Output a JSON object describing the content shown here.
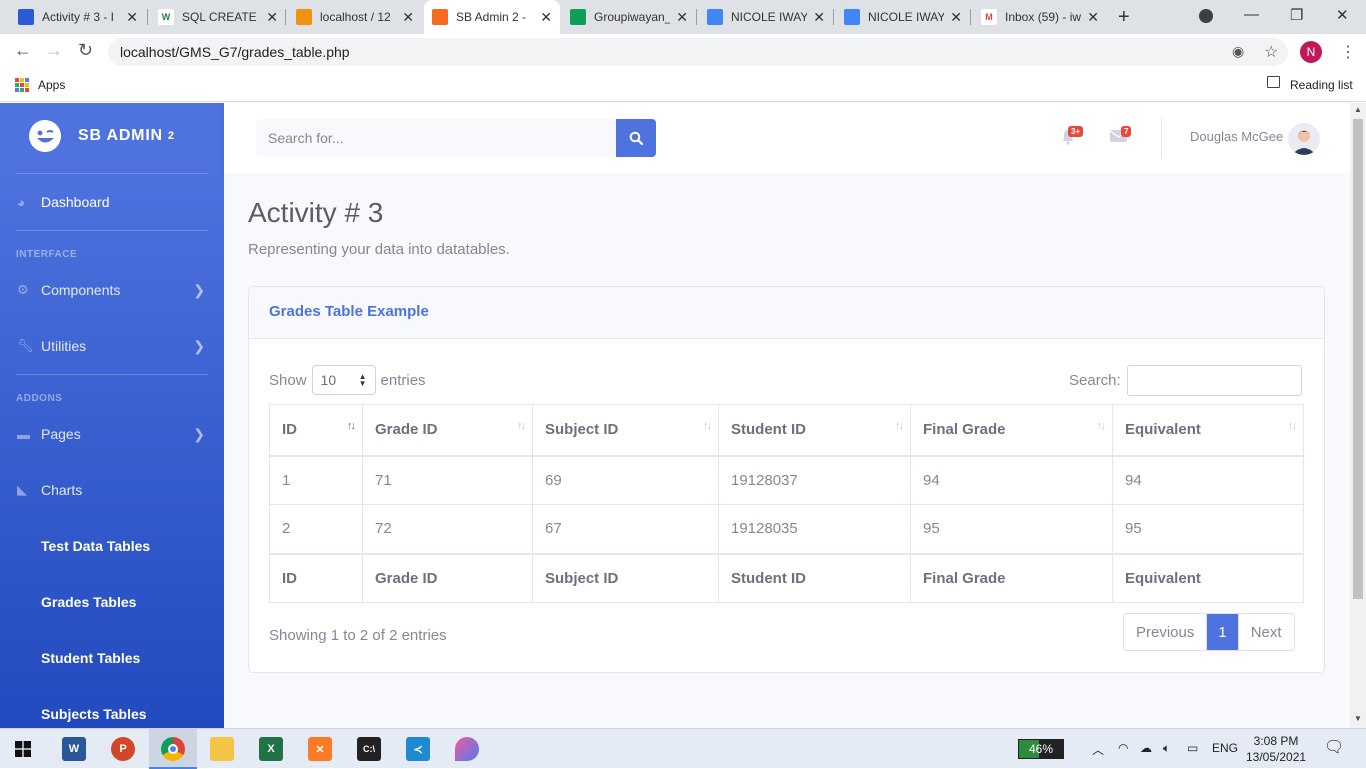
{
  "browser": {
    "tabs": [
      {
        "label": "Activity # 3 - I",
        "icon_color": "#2a5bd7",
        "icon_text": ""
      },
      {
        "label": "SQL CREATE T",
        "icon_color": "#000000",
        "icon_text": "W"
      },
      {
        "label": "localhost / 12",
        "icon_color": "#f29111",
        "icon_text": ""
      },
      {
        "label": "SB Admin 2 -",
        "icon_color": "#f26b21",
        "icon_text": ""
      },
      {
        "label": "Groupiwayan_",
        "icon_color": "#0f9d58",
        "icon_text": ""
      },
      {
        "label": "NICOLE IWAY",
        "icon_color": "#4285f4",
        "icon_text": ""
      },
      {
        "label": "NICOLE IWAY",
        "icon_color": "#4285f4",
        "icon_text": ""
      },
      {
        "label": "Inbox (59) - iw",
        "icon_color": "#ea4335",
        "icon_text": "M"
      }
    ],
    "url": "localhost/GMS_G7/grades_table.php",
    "profile_initial": "N",
    "bookmarks": {
      "apps_label": "Apps",
      "reading_list": "Reading list"
    }
  },
  "sidebar": {
    "brand": "SB ADMIN",
    "brand_sup": "2",
    "dashboard": "Dashboard",
    "heading_interface": "INTERFACE",
    "components": "Components",
    "utilities": "Utilities",
    "heading_addons": "ADDONS",
    "pages": "Pages",
    "charts": "Charts",
    "sub_items": [
      "Test Data Tables",
      "Grades Tables",
      "Student Tables",
      "Subjects Tables"
    ]
  },
  "topbar": {
    "search_placeholder": "Search for...",
    "alerts_badge": "3+",
    "messages_badge": "7",
    "user_name": "Douglas McGee"
  },
  "page": {
    "title": "Activity # 3",
    "subtitle": "Representing your data into datatables."
  },
  "card": {
    "header": "Grades Table Example",
    "show_label": "Show",
    "entries_value": "10",
    "entries_label": "entries",
    "search_label": "Search:",
    "columns": [
      "ID",
      "Grade ID",
      "Subject ID",
      "Student ID",
      "Final Grade",
      "Equivalent"
    ],
    "rows": [
      [
        "1",
        "71",
        "69",
        "19128037",
        "94",
        "94"
      ],
      [
        "2",
        "72",
        "67",
        "19128035",
        "95",
        "95"
      ]
    ],
    "info": "Showing 1 to 2 of 2 entries",
    "pager": {
      "previous": "Previous",
      "current": "1",
      "next": "Next"
    }
  },
  "taskbar": {
    "battery": "46%",
    "battery_level": 0.46,
    "language": "ENG",
    "time": "3:08 PM",
    "date": "13/05/2021"
  }
}
